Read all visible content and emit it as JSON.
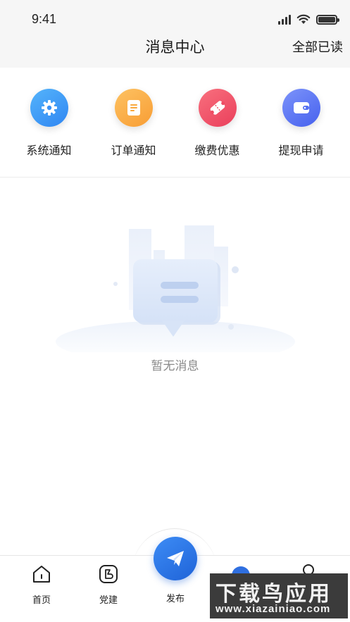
{
  "status_bar": {
    "time": "9:41"
  },
  "header": {
    "title": "消息中心",
    "mark_all_read": "全部已读"
  },
  "categories": [
    {
      "label": "系统通知",
      "icon": "gear-icon",
      "color": "#3f9af8"
    },
    {
      "label": "订单通知",
      "icon": "document-icon",
      "color": "#fbad45"
    },
    {
      "label": "缴费优惠",
      "icon": "coupon-icon",
      "color": "#f1566a"
    },
    {
      "label": "提现申请",
      "icon": "wallet-icon",
      "color": "#5b74f5"
    }
  ],
  "empty_state": {
    "text": "暂无消息"
  },
  "tabbar": {
    "home": "首页",
    "party": "党建",
    "publish": "发布"
  },
  "watermark": {
    "title": "下载鸟应用",
    "url": "www.xiazainiao.com"
  }
}
